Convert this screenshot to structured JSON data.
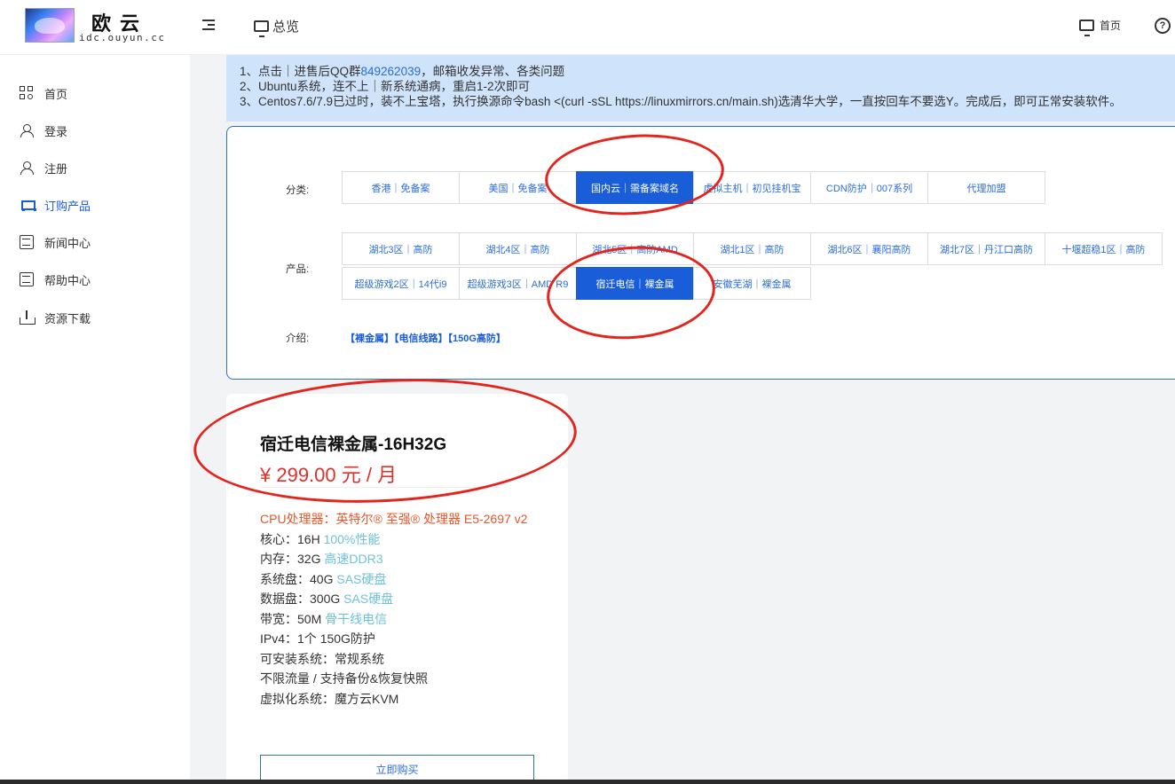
{
  "header": {
    "brand": "欧云",
    "brand_url": "idc.ouyun.cc",
    "overview_label": "总览",
    "home_label": "首页",
    "help_glyph": "?"
  },
  "sidebar": {
    "items": [
      {
        "label": "首页",
        "icon": "grid-icon"
      },
      {
        "label": "登录",
        "icon": "user-icon"
      },
      {
        "label": "注册",
        "icon": "user-icon"
      },
      {
        "label": "订购产品",
        "icon": "cart-icon",
        "active": true
      },
      {
        "label": "新闻中心",
        "icon": "document-icon"
      },
      {
        "label": "帮助中心",
        "icon": "document-icon"
      },
      {
        "label": "资源下载",
        "icon": "download-icon"
      }
    ],
    "active_color": "#1a5dd8"
  },
  "notice": {
    "line1_prefix": "1、点击｜进售后QQ群",
    "line1_link": "849262039",
    "line1_suffix": "，邮箱收发异常、各类问题",
    "line2": "2、Ubuntu系统，连不上｜新系统通病，重启1-2次即可",
    "line3": "3、Centos7.6/7.9已过时，装不上宝塔，执行换源命令bash <(curl -sSL https://linuxmirrors.cn/main.sh)选清华大学，一直按回车不要选Y。完成后，即可正常安装软件。"
  },
  "catalog": {
    "category_label": "分类:",
    "categories": [
      "香港｜免备案",
      "美国｜免备案",
      "国内云｜需备案域名",
      "虚拟主机｜初见挂机宝",
      "CDN防护｜007系列",
      "代理加盟"
    ],
    "selected_category": "国内云｜需备案域名",
    "product_label": "产品:",
    "products_row1": [
      "湖北3区｜高防",
      "湖北4区｜高防",
      "湖北5区｜高防AMD",
      "湖北1区｜高防",
      "湖北6区｜襄阳高防",
      "湖北7区｜丹江口高防",
      "十堰超稳1区｜高防"
    ],
    "products_row2": [
      "超级游戏2区｜14代i9",
      "超级游戏3区｜AMD R9",
      "宿迁电信｜裸金属",
      "安徽芜湖｜裸金属"
    ],
    "selected_product": "宿迁电信｜裸金属",
    "intro_label": "介绍:",
    "intro_text": "【裸金属】【电信线路】【150G高防】"
  },
  "product": {
    "name": "宿迁电信裸金属-16H32G",
    "price": "¥ 299.00 元 / 月",
    "cpu": "CPU处理器：英特尔® 至强® 处理器 E5-2697 v2",
    "specs": [
      {
        "label": "核心：16H ",
        "highlight": "100%性能"
      },
      {
        "label": "内存：32G ",
        "highlight": "高速DDR3"
      },
      {
        "label": "系统盘：40G ",
        "highlight": "SAS硬盘"
      },
      {
        "label": "数据盘：300G ",
        "highlight": "SAS硬盘"
      },
      {
        "label": "带宽：50M ",
        "highlight": "骨干线电信"
      }
    ],
    "plain_specs": [
      "IPv4：1个 150G防护",
      "可安装系统：常规系统",
      "不限流量 / 支持备份&恢复快照",
      "虚拟化系统：魔方云KVM"
    ],
    "buy_label": "立即购买",
    "price_color": "#e0302c"
  }
}
